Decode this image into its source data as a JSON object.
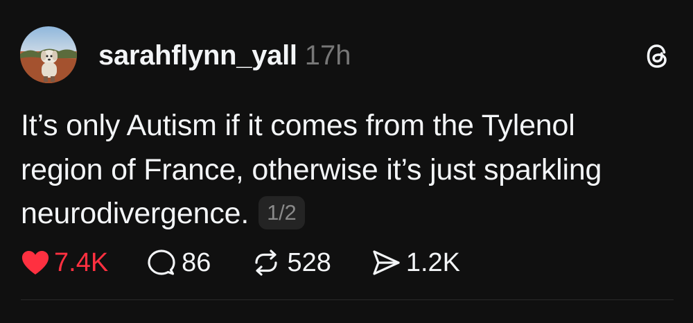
{
  "post": {
    "username": "sarahflynn_yall",
    "timestamp": "17h",
    "body_lines": [
      "It’s only Autism if it comes from the Tylenol",
      "region of France, otherwise it’s just sparkling",
      "neurodivergence."
    ],
    "page_badge": "1/2",
    "stats": {
      "likes": "7.4K",
      "replies": "86",
      "reposts": "528",
      "shares": "1.2K"
    },
    "liked": true
  },
  "icons": {
    "brand": "threads-logo-icon",
    "like": "heart-filled-icon",
    "reply": "speech-bubble-icon",
    "repost": "repost-arrows-icon",
    "share": "paper-plane-icon"
  },
  "colors": {
    "background": "#101010",
    "text": "#f3f5f7",
    "secondary_text": "#777777",
    "like_red": "#ff3040",
    "badge_bg": "#242424"
  }
}
